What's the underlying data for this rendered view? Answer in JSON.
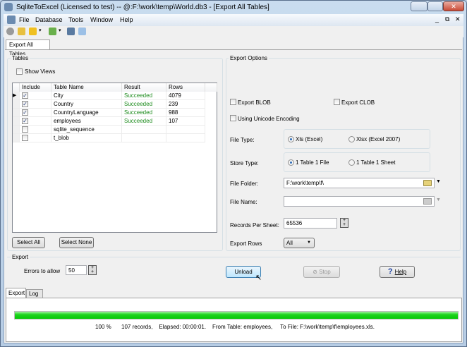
{
  "title": "SqliteToExcel (Licensed to test)  -- @:F:\\work\\temp\\World.db3 - [Export All Tables]",
  "menu": [
    "File",
    "Database",
    "Tools",
    "Window",
    "Help"
  ],
  "doc_tab": "Export All Tables",
  "tables": {
    "group_label": "Tables",
    "show_views": "Show Views",
    "columns": [
      "Include",
      "Table Name",
      "Result",
      "Rows"
    ],
    "rows": [
      {
        "include": true,
        "name": "City",
        "result": "Succeeded",
        "rows": "4079"
      },
      {
        "include": true,
        "name": "Country",
        "result": "Succeeded",
        "rows": "239"
      },
      {
        "include": true,
        "name": "CountryLanguage",
        "result": "Succeeded",
        "rows": "988"
      },
      {
        "include": true,
        "name": "employees",
        "result": "Succeeded",
        "rows": "107"
      },
      {
        "include": false,
        "name": "sqlite_sequence",
        "result": "",
        "rows": ""
      },
      {
        "include": false,
        "name": "t_blob",
        "result": "",
        "rows": ""
      }
    ],
    "select_all": "Select All",
    "select_none": "Select None"
  },
  "options": {
    "group_label": "Export Options",
    "export_blob": "Export BLOB",
    "export_clob": "Export CLOB",
    "unicode": "Using Unicode Encoding",
    "file_type_label": "File Type:",
    "file_type_xls": "Xls (Excel)",
    "file_type_xlsx": "Xlsx (Excel 2007)",
    "store_type_label": "Store Type:",
    "store_1file": "1 Table 1 File",
    "store_1sheet": "1 Table 1 Sheet",
    "folder_label": "File Folder:",
    "folder_value": "F:\\work\\temp\\f\\",
    "name_label": "File Name:",
    "name_value": "",
    "records_label": "Records Per Sheet:",
    "records_value": "65536",
    "rows_label": "Export Rows",
    "rows_value": "All"
  },
  "export": {
    "group_label": "Export",
    "errors_label": "Errors to allow",
    "errors_value": "50",
    "unload": "Unload",
    "stop": "Stop",
    "help": "Help"
  },
  "bottom_tabs": [
    "Export",
    "Log"
  ],
  "progress": {
    "percent": 100,
    "percent_text": "100 %",
    "status": "107 records,    Elapsed: 00:00:01.    From Table: employees,     To File: F:\\work\\temp\\f\\employees.xls."
  }
}
